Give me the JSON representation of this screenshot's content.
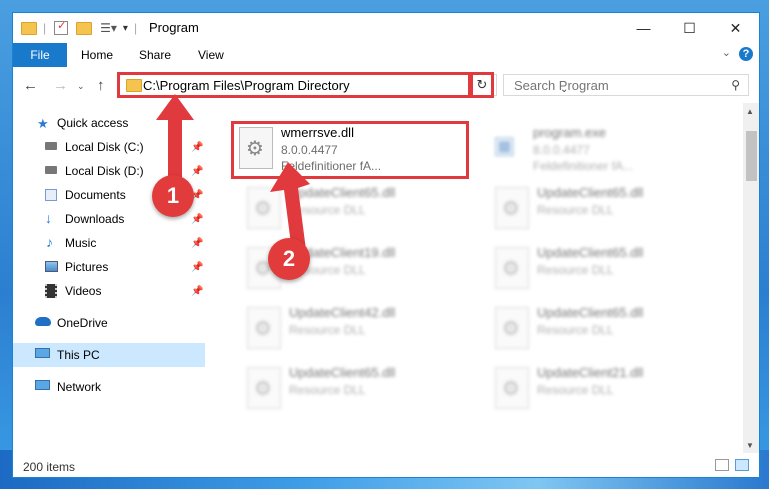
{
  "window": {
    "title": "Program"
  },
  "ribbon": {
    "file_label": "File",
    "tabs": [
      "Home",
      "Share",
      "View"
    ],
    "help_label": "?"
  },
  "address": {
    "path": "C:\\Program Files\\Program Directory"
  },
  "search": {
    "placeholder": "Search Program"
  },
  "sidebar": {
    "quick_access": "Quick access",
    "quick_items": [
      {
        "label": "Local Disk (C:)",
        "icon": "drive-icon"
      },
      {
        "label": "Local Disk (D:)",
        "icon": "drive-icon"
      },
      {
        "label": "Documents",
        "icon": "documents-icon"
      },
      {
        "label": "Downloads",
        "icon": "downloads-icon"
      },
      {
        "label": "Music",
        "icon": "music-icon"
      },
      {
        "label": "Pictures",
        "icon": "pictures-icon"
      },
      {
        "label": "Videos",
        "icon": "videos-icon"
      }
    ],
    "onedrive": "OneDrive",
    "this_pc": "This PC",
    "network": "Network"
  },
  "files": [
    {
      "name": "wmerrsve.dll",
      "line1": "8.0.0.4477",
      "line2": "Feldefinitioner fA...",
      "highlighted": true
    },
    {
      "name": "program.exe",
      "line1": "8.0.0.4477",
      "line2": "Feldefinitioner fA..."
    },
    {
      "name": "UpdateClient65.dll",
      "line1": "Resource DLL"
    },
    {
      "name": "UpdateClient65.dll",
      "line1": "Resource DLL"
    },
    {
      "name": "UpdateClient19.dll",
      "line1": "Resource DLL"
    },
    {
      "name": "UpdateClient65.dll",
      "line1": "Resource DLL"
    },
    {
      "name": "UpdateClient42.dll",
      "line1": "Resource DLL"
    },
    {
      "name": "UpdateClient65.dll",
      "line1": "Resource DLL"
    },
    {
      "name": "UpdateClient65.dll",
      "line1": "Resource DLL"
    },
    {
      "name": "UpdateClient21.dll",
      "line1": "Resource DLL"
    }
  ],
  "status": {
    "items": "200 items"
  },
  "annotations": {
    "badge1": "1",
    "badge2": "2"
  },
  "colors": {
    "accent": "#1979ca",
    "highlight": "#e0393e",
    "selected": "#cce8ff"
  }
}
